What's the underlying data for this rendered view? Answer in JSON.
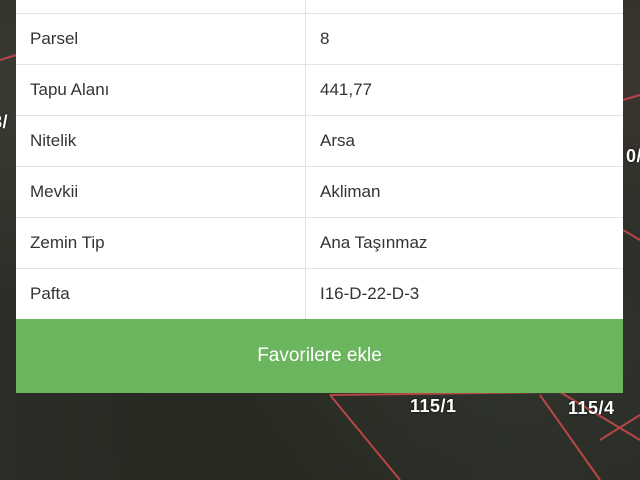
{
  "map": {
    "parcel_labels": [
      "115/1",
      "115/4",
      "8/",
      "0/"
    ]
  },
  "table": {
    "rows": [
      {
        "key": "",
        "value": ""
      },
      {
        "key": "Parsel",
        "value": "8"
      },
      {
        "key": "Tapu Alanı",
        "value": "441,77"
      },
      {
        "key": "Nitelik",
        "value": "Arsa"
      },
      {
        "key": "Mevkii",
        "value": "Akliman"
      },
      {
        "key": "Zemin Tip",
        "value": "Ana Taşınmaz"
      },
      {
        "key": "Pafta",
        "value": "I16-D-22-D-3"
      }
    ]
  },
  "actions": {
    "favorite_label": "Favorilere ekle"
  },
  "colors": {
    "button": "#6cb55f",
    "parcel_lines": "#c0504d"
  }
}
